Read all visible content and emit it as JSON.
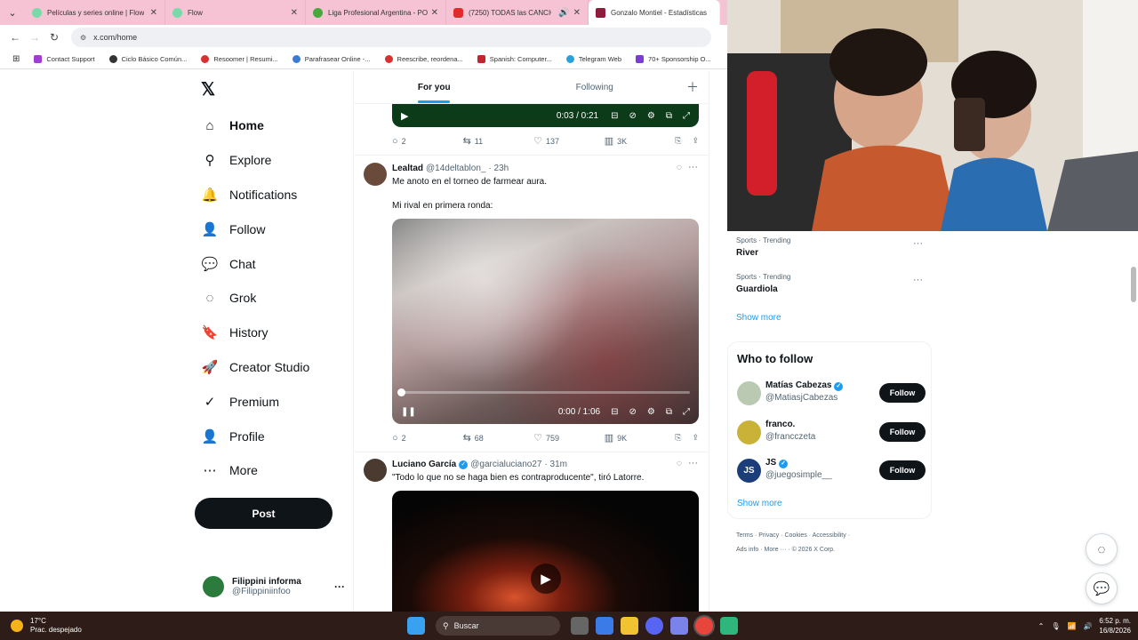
{
  "browser": {
    "tabs": [
      {
        "title": "Películas y series online | Flow",
        "color": "#7ad9a8"
      },
      {
        "title": "Flow",
        "color": "#7ad9a8"
      },
      {
        "title": "Liga Profesional Argentina - PO",
        "color": "#49a83c"
      },
      {
        "title": "(7250) TODAS las CANCION",
        "color": "#e22b2b"
      },
      {
        "title": "Gonzalo Montiel - Estadísticas",
        "color": "#8b1d3d"
      }
    ],
    "url": "x.com/home",
    "bookmarks": [
      {
        "label": "Contact Support",
        "color": "#a13cd4"
      },
      {
        "label": "Ciclo Básico Común...",
        "color": "#333333"
      },
      {
        "label": "Resoomer | Resumi...",
        "color": "#d73030"
      },
      {
        "label": "Parafrasear Online -...",
        "color": "#3c7bd4"
      },
      {
        "label": "Reescribe, reordena...",
        "color": "#d73030"
      },
      {
        "label": "Spanish: Computer...",
        "color": "#c0262b"
      },
      {
        "label": "Telegram Web",
        "color": "#2aa1da"
      },
      {
        "label": "70+ Sponsorship O...",
        "color": "#7a3cd4"
      }
    ]
  },
  "sidebar": {
    "logo": "𝕏",
    "items": [
      {
        "label": "Home",
        "icon": "⌂"
      },
      {
        "label": "Explore",
        "icon": "⚲"
      },
      {
        "label": "Notifications",
        "icon": "🔔"
      },
      {
        "label": "Follow",
        "icon": "👤"
      },
      {
        "label": "Chat",
        "icon": "💬"
      },
      {
        "label": "Grok",
        "icon": "◌"
      },
      {
        "label": "History",
        "icon": "🔖"
      },
      {
        "label": "Creator Studio",
        "icon": "🚀"
      },
      {
        "label": "Premium",
        "icon": "✓"
      },
      {
        "label": "Profile",
        "icon": "👤"
      },
      {
        "label": "More",
        "icon": "⋯"
      }
    ],
    "post_label": "Post",
    "account": {
      "name": "Filippini informa",
      "handle": "@Filippiniinfoo"
    }
  },
  "feed": {
    "tabs": [
      "For you",
      "Following"
    ],
    "top_video": {
      "time": "0:03 / 0:21",
      "replies": "2",
      "reposts": "11",
      "likes": "137",
      "views": "3K"
    },
    "tweet1": {
      "name": "Lealtad",
      "handle": "@14deltablon_",
      "time": "· 23h",
      "text1": "Me anoto en el torneo de farmear aura.",
      "text2": "Mi rival en primera ronda:",
      "video_time": "0:00 / 1:06",
      "replies": "2",
      "reposts": "68",
      "likes": "759",
      "views": "9K"
    },
    "tweet2": {
      "name": "Luciano García",
      "handle": "@garcialuciano27",
      "time": "· 31m",
      "text": "\"Todo lo que no se haga bien es contraproducente\", tiró Latorre."
    }
  },
  "trends": [
    {
      "category": "Sports · Trending",
      "name": "River"
    },
    {
      "category": "Sports · Trending",
      "name": "Guardiola"
    }
  ],
  "show_more": "Show more",
  "who_to_follow": {
    "title": "Who to follow",
    "users": [
      {
        "name": "Matías Cabezas",
        "handle": "@MatiasjCabezas",
        "verified": true,
        "button": "Follow"
      },
      {
        "name": "franco.",
        "handle": "@francczeta",
        "verified": false,
        "button": "Follow"
      },
      {
        "name": "JS",
        "handle": "@juegosimple__",
        "verified": true,
        "button": "Follow"
      }
    ],
    "show_more": "Show more"
  },
  "footer": {
    "line1": [
      "Terms",
      "Privacy",
      "Cookies",
      "Accessibility"
    ],
    "line2": [
      "Ads info",
      "More ···",
      "© 2026 X Corp."
    ]
  },
  "taskbar": {
    "temp": "17°C",
    "weather": "Prac. despejado",
    "search": "Buscar",
    "time": "6:52 p. m.",
    "date": "16/8/2026"
  }
}
